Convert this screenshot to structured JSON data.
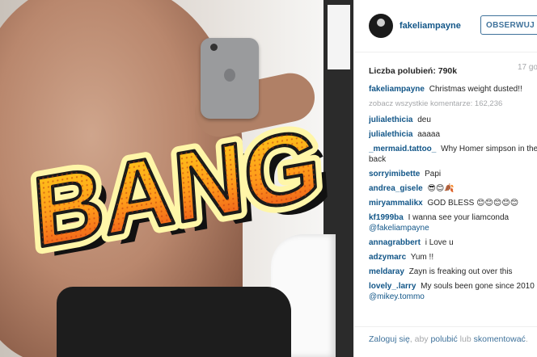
{
  "post": {
    "username": "fakeliampayne",
    "follow_label": "OBSERWUJ",
    "likes": "Liczba polubień: 790k",
    "date": "17 go",
    "overlay_text": "BANG"
  },
  "caption": {
    "username": "fakeliampayne",
    "text": "Christmas weight dusted!!"
  },
  "view_all": "zobacz wszystkie komentarze: 162,236",
  "comments": [
    {
      "user": "julialethicia",
      "text": "deu"
    },
    {
      "user": "julialethicia",
      "text": "aaaaa"
    },
    {
      "user": "_mermaid.tattoo_",
      "text": "Why Homer simpson in the back"
    },
    {
      "user": "sorryimibette",
      "text": "Papi"
    },
    {
      "user": "andrea_gisele",
      "text": "😎😊🍂"
    },
    {
      "user": "miryammalikx",
      "text": "GOD BLESS 😊😊😊😊😊"
    },
    {
      "user": "kf1999ba",
      "text": "I wanna see your liamconda",
      "mention": "@fakeliampayne"
    },
    {
      "user": "annagrabbert",
      "text": "i Love u"
    },
    {
      "user": "adzymarc",
      "text": "Yum !!"
    },
    {
      "user": "meldaray",
      "text": "Zayn is freaking out over this"
    },
    {
      "user": "lovely_.larry",
      "text": "My souls been gone since 2010",
      "mention": "@mikey.tommo"
    }
  ],
  "footer": {
    "login_link": "Zaloguj się",
    "rest_before": ", aby ",
    "like_link": "polubić",
    "mid": " lub ",
    "comment_link": "skomentować",
    "end": "."
  },
  "colors": {
    "link": "#125688",
    "button": "#3f729b",
    "muted": "#a5a7aa"
  }
}
